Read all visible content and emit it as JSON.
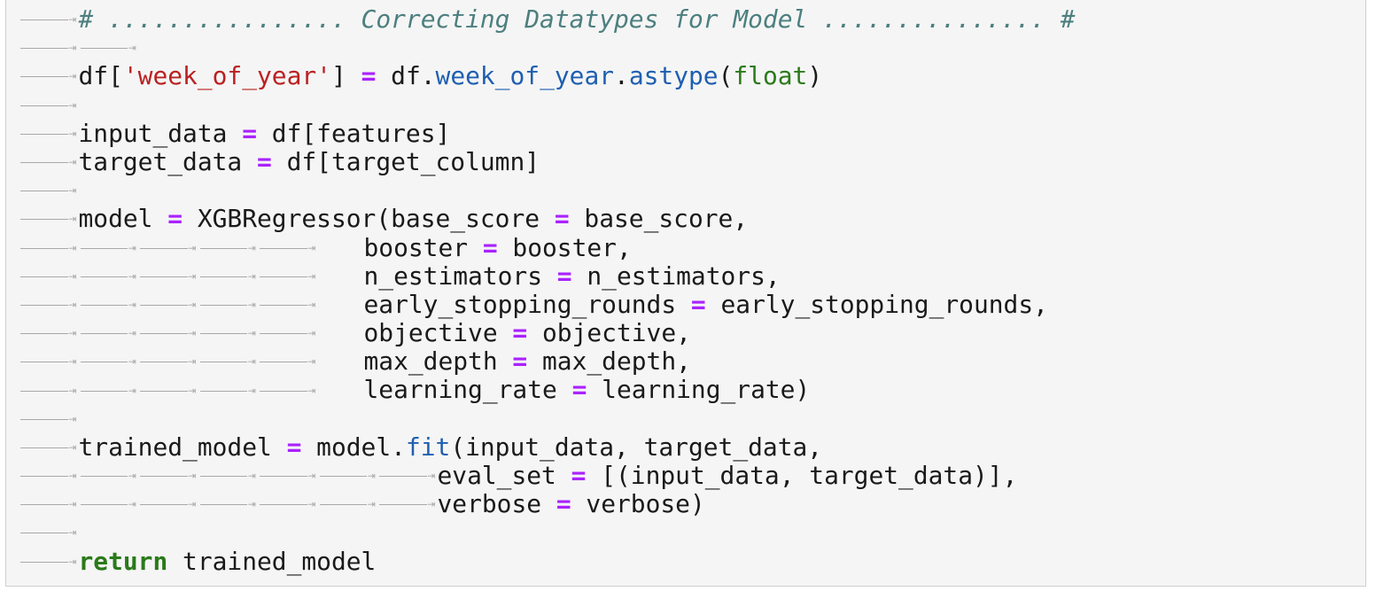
{
  "lines": [
    {
      "tabs": 1,
      "pad": 0,
      "tokens": [
        {
          "t": "# ................ Correcting Datatypes for Model ............... #",
          "c": "comment"
        }
      ]
    },
    {
      "tabs": 2,
      "pad": 0,
      "tokens": []
    },
    {
      "tabs": 1,
      "pad": 0,
      "tokens": [
        {
          "t": "df[",
          "c": "plain"
        },
        {
          "t": "'week_of_year'",
          "c": "string"
        },
        {
          "t": "] ",
          "c": "plain"
        },
        {
          "t": "=",
          "c": "op"
        },
        {
          "t": " df.",
          "c": "plain"
        },
        {
          "t": "week_of_year",
          "c": "attr"
        },
        {
          "t": ".",
          "c": "plain"
        },
        {
          "t": "astype",
          "c": "attr"
        },
        {
          "t": "(",
          "c": "plain"
        },
        {
          "t": "float",
          "c": "builtin"
        },
        {
          "t": ")",
          "c": "plain"
        }
      ]
    },
    {
      "tabs": 1,
      "pad": 0,
      "tokens": []
    },
    {
      "tabs": 1,
      "pad": 0,
      "tokens": [
        {
          "t": "input_data ",
          "c": "plain"
        },
        {
          "t": "=",
          "c": "op"
        },
        {
          "t": " df[features]",
          "c": "plain"
        }
      ]
    },
    {
      "tabs": 1,
      "pad": 0,
      "tokens": [
        {
          "t": "target_data ",
          "c": "plain"
        },
        {
          "t": "=",
          "c": "op"
        },
        {
          "t": " df[target_column]",
          "c": "plain"
        }
      ]
    },
    {
      "tabs": 1,
      "pad": 0,
      "tokens": []
    },
    {
      "tabs": 1,
      "pad": 0,
      "tokens": [
        {
          "t": "model ",
          "c": "plain"
        },
        {
          "t": "=",
          "c": "op"
        },
        {
          "t": " XGBRegressor(base_score ",
          "c": "plain"
        },
        {
          "t": "=",
          "c": "op"
        },
        {
          "t": " base_score,",
          "c": "plain"
        }
      ]
    },
    {
      "tabs": 5,
      "pad": 1,
      "tokens": [
        {
          "t": "booster ",
          "c": "plain"
        },
        {
          "t": "=",
          "c": "op"
        },
        {
          "t": " booster,",
          "c": "plain"
        }
      ]
    },
    {
      "tabs": 5,
      "pad": 1,
      "tokens": [
        {
          "t": "n_estimators ",
          "c": "plain"
        },
        {
          "t": "=",
          "c": "op"
        },
        {
          "t": " n_estimators,",
          "c": "plain"
        }
      ]
    },
    {
      "tabs": 5,
      "pad": 1,
      "tokens": [
        {
          "t": "early_stopping_rounds ",
          "c": "plain"
        },
        {
          "t": "=",
          "c": "op"
        },
        {
          "t": " early_stopping_rounds,",
          "c": "plain"
        }
      ]
    },
    {
      "tabs": 5,
      "pad": 1,
      "tokens": [
        {
          "t": "objective ",
          "c": "plain"
        },
        {
          "t": "=",
          "c": "op"
        },
        {
          "t": " objective,",
          "c": "plain"
        }
      ]
    },
    {
      "tabs": 5,
      "pad": 1,
      "tokens": [
        {
          "t": "max_depth ",
          "c": "plain"
        },
        {
          "t": "=",
          "c": "op"
        },
        {
          "t": " max_depth,",
          "c": "plain"
        }
      ]
    },
    {
      "tabs": 5,
      "pad": 1,
      "tokens": [
        {
          "t": "learning_rate ",
          "c": "plain"
        },
        {
          "t": "=",
          "c": "op"
        },
        {
          "t": " learning_rate)",
          "c": "plain"
        }
      ]
    },
    {
      "tabs": 1,
      "pad": 0,
      "tokens": []
    },
    {
      "tabs": 1,
      "pad": 0,
      "tokens": [
        {
          "t": "trained_model ",
          "c": "plain"
        },
        {
          "t": "=",
          "c": "op"
        },
        {
          "t": " model.",
          "c": "plain"
        },
        {
          "t": "fit",
          "c": "attr"
        },
        {
          "t": "(input_data, target_data,",
          "c": "plain"
        }
      ]
    },
    {
      "tabs": 7,
      "pad": 0,
      "tokens": [
        {
          "t": "eval_set ",
          "c": "plain"
        },
        {
          "t": "=",
          "c": "op"
        },
        {
          "t": " [(input_data, target_data)],",
          "c": "plain"
        }
      ]
    },
    {
      "tabs": 7,
      "pad": 0,
      "tokens": [
        {
          "t": "verbose ",
          "c": "plain"
        },
        {
          "t": "=",
          "c": "op"
        },
        {
          "t": " verbose)",
          "c": "plain"
        }
      ]
    },
    {
      "tabs": 1,
      "pad": 0,
      "tokens": []
    },
    {
      "tabs": 1,
      "pad": 0,
      "tokens": [
        {
          "t": "return",
          "c": "keyword"
        },
        {
          "t": " trained_model",
          "c": "plain"
        }
      ]
    }
  ]
}
